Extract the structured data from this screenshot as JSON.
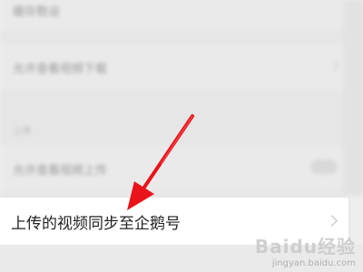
{
  "settings": {
    "row_top": {
      "label": "缓存数设",
      "value": ""
    },
    "row_download": {
      "label": "允许查看视频下载"
    },
    "section_header": "上传",
    "row_upload": {
      "label": "允许查看视频上传"
    },
    "active_row": {
      "label": "上传的视频同步至企鹅号"
    }
  },
  "annotation": {
    "color": "#e8141a"
  },
  "watermark": {
    "logo": "Baidu经验",
    "url": "jingyan.baidu.com"
  }
}
